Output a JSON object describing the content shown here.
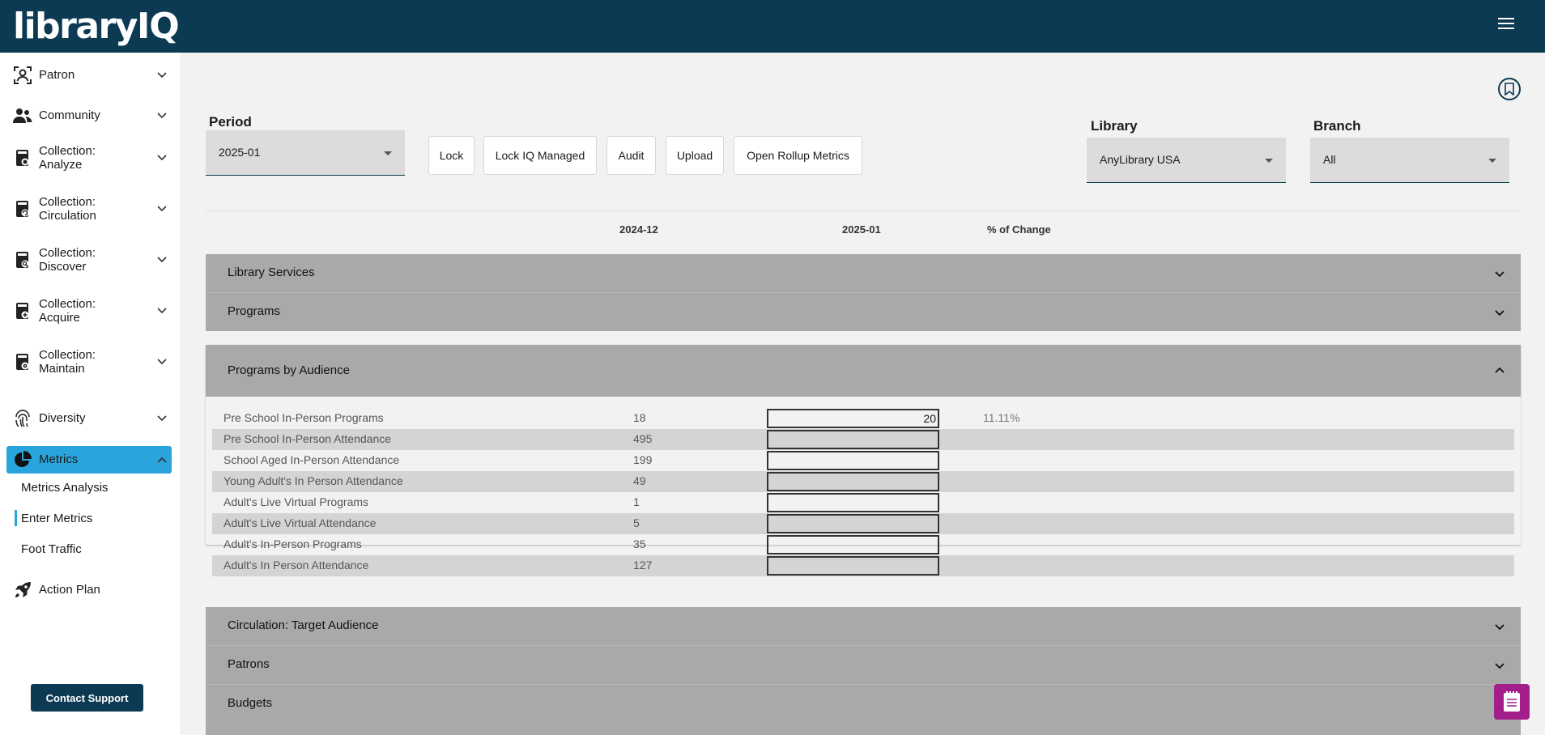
{
  "app": {
    "logo_main": "library",
    "logo_accent": "IQ"
  },
  "sidebar": {
    "items": [
      {
        "label": "Patron",
        "icon": "patron-icon"
      },
      {
        "label": "Community",
        "icon": "community-icon"
      },
      {
        "label": "Collection: Analyze",
        "line1": "Collection:",
        "line2": "Analyze",
        "icon": "collection-analyze-icon"
      },
      {
        "label": "Collection: Circulation",
        "line1": "Collection:",
        "line2": "Circulation",
        "icon": "collection-circulation-icon"
      },
      {
        "label": "Collection: Discover",
        "line1": "Collection:",
        "line2": "Discover",
        "icon": "collection-discover-icon"
      },
      {
        "label": "Collection: Acquire",
        "line1": "Collection:",
        "line2": "Acquire",
        "icon": "collection-acquire-icon"
      },
      {
        "label": "Collection: Maintain",
        "line1": "Collection:",
        "line2": "Maintain",
        "icon": "collection-maintain-icon"
      },
      {
        "label": "Diversity",
        "icon": "fingerprint-icon"
      },
      {
        "label": "Metrics",
        "icon": "pie-chart-icon",
        "active": true
      },
      {
        "label": "Action Plan",
        "icon": "rocket-icon"
      }
    ],
    "metrics_sub": [
      {
        "label": "Metrics Analysis",
        "selected": false
      },
      {
        "label": "Enter Metrics",
        "selected": true
      },
      {
        "label": "Foot Traffic",
        "selected": false
      }
    ],
    "contact_support": "Contact Support"
  },
  "toolbar": {
    "period_label": "Period",
    "period_value": "2025-01",
    "buttons": [
      "Lock",
      "Lock IQ Managed",
      "Audit",
      "Upload",
      "Open Rollup Metrics"
    ],
    "library_label": "Library",
    "library_value": "AnyLibrary USA",
    "branch_label": "Branch",
    "branch_value": "All"
  },
  "columns": {
    "prev": "2024-12",
    "curr": "2025-01",
    "change": "% of Change"
  },
  "sections_top": [
    "Library Services",
    "Programs"
  ],
  "expanded_section": {
    "title": "Programs by Audience",
    "rows": [
      {
        "label": "Pre School In-Person Programs",
        "prev": "18",
        "curr": "20",
        "change": "11.11%"
      },
      {
        "label": "Pre School In-Person Attendance",
        "prev": "495",
        "curr": "",
        "change": ""
      },
      {
        "label": "School Aged In-Person Attendance",
        "prev": "199",
        "curr": "",
        "change": ""
      },
      {
        "label": "Young Adult's In Person Attendance",
        "prev": "49",
        "curr": "",
        "change": ""
      },
      {
        "label": "Adult's Live Virtual Programs",
        "prev": "1",
        "curr": "",
        "change": ""
      },
      {
        "label": "Adult's Live Virtual Attendance",
        "prev": "5",
        "curr": "",
        "change": ""
      },
      {
        "label": "Adult's In-Person Programs",
        "prev": "35",
        "curr": "",
        "change": ""
      },
      {
        "label": "Adult's In Person Attendance",
        "prev": "127",
        "curr": "",
        "change": ""
      }
    ]
  },
  "sections_bottom": [
    "Circulation: Target Audience",
    "Patrons",
    "Budgets"
  ],
  "colors": {
    "header": "#0b3a52",
    "accent": "#2aa4dc",
    "section": "#a9a9a9",
    "notes": "#a11e8b"
  }
}
